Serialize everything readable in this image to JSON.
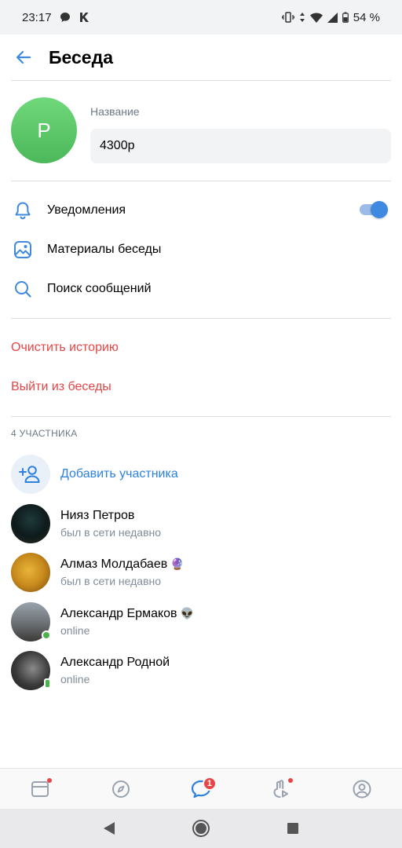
{
  "status_bar": {
    "time": "23:17",
    "battery": "54 %",
    "icons": [
      "chat-bubble-icon",
      "k-icon",
      "vibrate-icon",
      "data-arrows-icon",
      "wifi-icon",
      "signal-icon",
      "battery-icon"
    ]
  },
  "header": {
    "title": "Беседа",
    "back_icon": "arrow-left-icon"
  },
  "chat_info": {
    "avatar_letter": "Р",
    "avatar_color": "#5cc564",
    "name_label": "Название",
    "name_value": "4300р"
  },
  "settings": [
    {
      "label": "Уведомления",
      "icon": "bell-icon",
      "toggle_on": true
    },
    {
      "label": "Материалы беседы",
      "icon": "image-icon"
    },
    {
      "label": "Поиск сообщений",
      "icon": "search-icon"
    }
  ],
  "actions": {
    "clear_history": "Очистить историю",
    "leave_chat": "Выйти из беседы"
  },
  "members": {
    "section_title": "4 УЧАСТНИКА",
    "add_label": "Добавить участника",
    "list": [
      {
        "name": "Нияз Петров",
        "status": "был в сети недавно",
        "emoji": ""
      },
      {
        "name": "Алмаз Молдабаев",
        "status": "был в сети недавно",
        "emoji": "🔮"
      },
      {
        "name": "Александр Ермаков",
        "status": "online",
        "emoji": "👽"
      },
      {
        "name": "Александр Родной",
        "status": "online",
        "emoji": ""
      }
    ]
  },
  "tabbar": {
    "items": [
      "news-icon",
      "compass-icon",
      "messages-icon",
      "clips-icon",
      "profile-icon"
    ],
    "messages_badge": "1"
  },
  "colors": {
    "accent": "#3f8ae0",
    "danger": "#e64646",
    "online": "#4bb34b",
    "secondary_text": "#818c99"
  }
}
